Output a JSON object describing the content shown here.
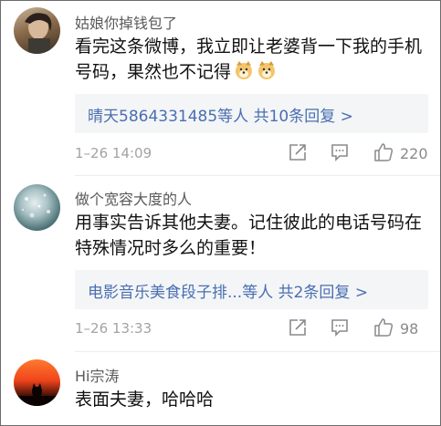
{
  "comments": [
    {
      "username": "姑娘你掉钱包了",
      "content_text": "看完这条微博，我立即让老婆背一下我的手机号码，果然也不记得",
      "emoji": [
        "doge-emoji",
        "doge-emoji"
      ],
      "reply_summary": "晴天5864331485等人 共10条回复 >",
      "time": "1–26 14:09",
      "likes": "220"
    },
    {
      "username": "做个宽容大度的人",
      "content_text": "用事实告诉其他夫妻。记住彼此的电话号码在特殊情况时多么的重要！",
      "reply_summary": "电影音乐美食段子排...等人 共2条回复 >",
      "time": "1–26 13:33",
      "likes": "98"
    },
    {
      "username": "Hi宗涛",
      "content_text": "表面夫妻，哈哈哈"
    }
  ],
  "icons": {
    "share": "share-icon",
    "comment": "comment-icon",
    "like": "thumbs-up-icon"
  },
  "colors": {
    "link": "#486fb0",
    "reply_bg": "#f4f5f7",
    "meta": "#a3a3a3"
  }
}
